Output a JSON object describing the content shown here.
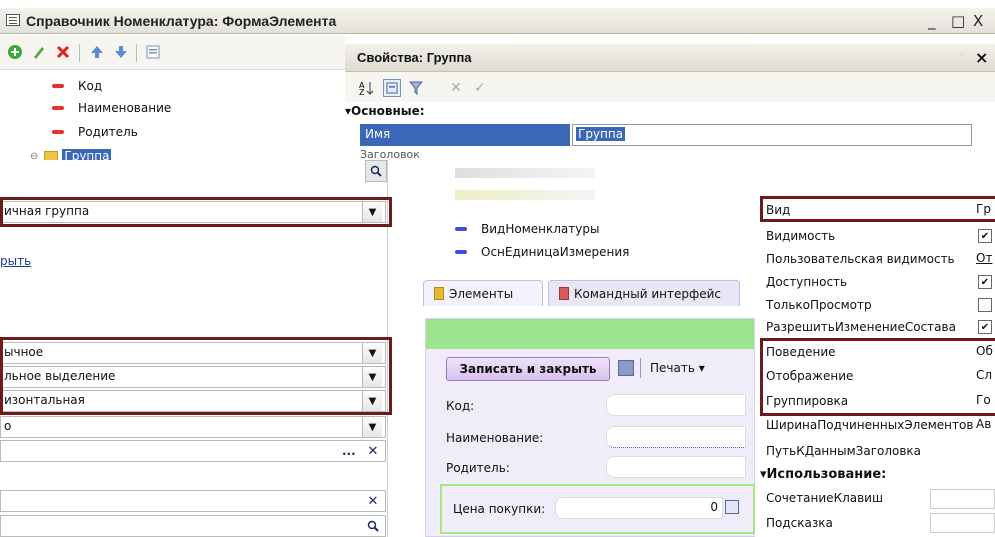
{
  "window": {
    "title": "Справочник Номенклатура: ФормаЭлемента",
    "min": "_",
    "max": "□",
    "close": "X"
  },
  "toolbar_icons": [
    "add-icon",
    "edit-icon",
    "delete-icon",
    "move-up-icon",
    "move-down-icon",
    "properties-icon"
  ],
  "tree": {
    "items": [
      "Код",
      "Наименование",
      "Родитель",
      "Группа"
    ]
  },
  "properties": {
    "title": "Свойства: Группа",
    "close": "×",
    "section_basic": "Основные:",
    "name_label": "Имя",
    "name_value": "Группа",
    "title_label": "Заголовок"
  },
  "left_panel": {
    "group_type": "ичная группа",
    "link": "рыть",
    "behavior": "ычное",
    "display": "льное выделение",
    "grouping": "изонтальная",
    "width_auto": "о",
    "ellipsis": "..."
  },
  "middle": {
    "tree_items": [
      "ВидНоменклатуры",
      "ОснЕдиницаИзмерения"
    ],
    "tabs": [
      "Элементы",
      "Командный интерфейс"
    ],
    "save_close": "Записать и закрыть",
    "print": "Печать ▾",
    "fields": [
      "Код:",
      "Наименование:",
      "Родитель:"
    ],
    "price_label": "Цена покупки:",
    "price_value": "0"
  },
  "right_props": {
    "rows": [
      {
        "label": "Вид",
        "value": "Гр"
      },
      {
        "label": "Видимость",
        "check": true
      },
      {
        "label": "Пользовательская видимость",
        "value": "От"
      },
      {
        "label": "Доступность",
        "check": true
      },
      {
        "label": "ТолькоПросмотр",
        "check": false
      },
      {
        "label": "РазрешитьИзменениеСостава",
        "check": true
      },
      {
        "label": "Поведение",
        "value": "Об"
      },
      {
        "label": "Отображение",
        "value": "Сл"
      },
      {
        "label": "Группировка",
        "value": "Го"
      },
      {
        "label": "ШиринаПодчиненныхЭлементов",
        "value": "Ав"
      },
      {
        "label": "ПутьКДаннымЗаголовка",
        "value": ""
      }
    ],
    "section_usage": "Использование:",
    "usage_rows": [
      "СочетаниеКлавиш",
      "Подсказка"
    ]
  }
}
